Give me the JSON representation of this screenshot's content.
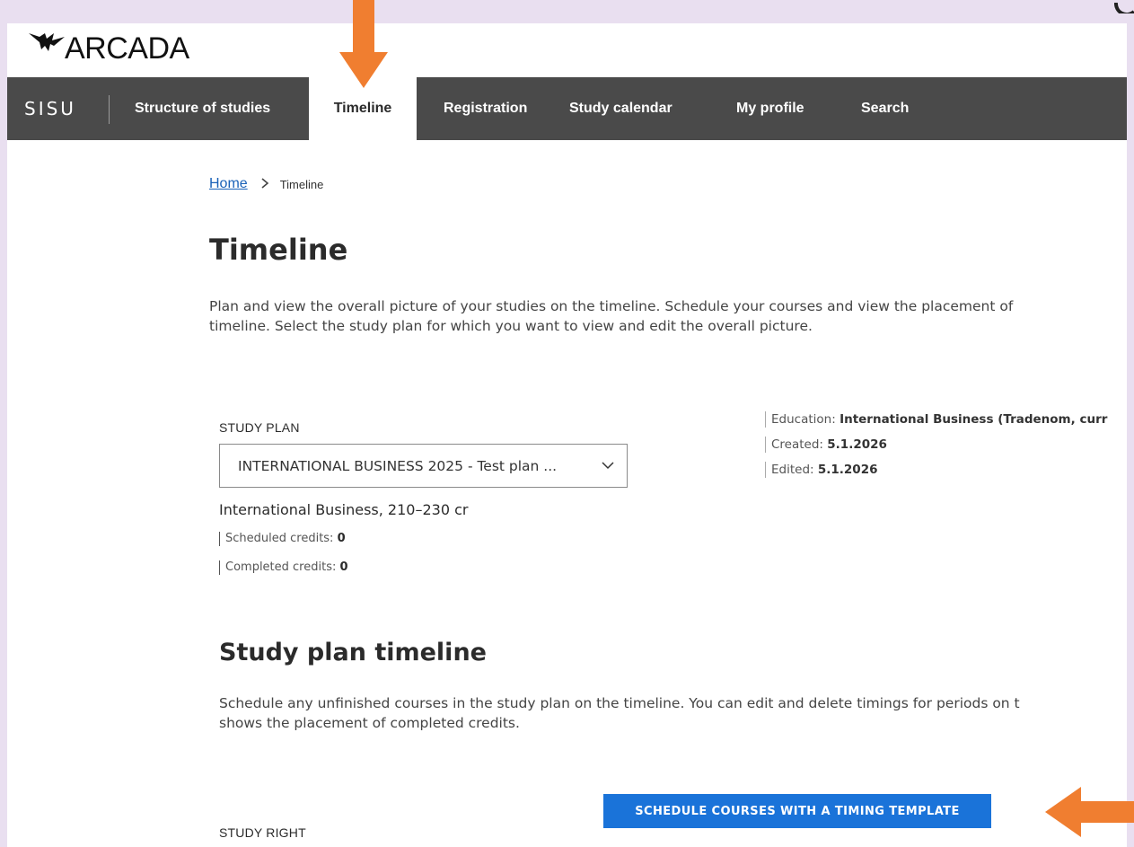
{
  "logo": {
    "text": "ARCADA"
  },
  "nav": {
    "brand": "SISU",
    "items": [
      {
        "label": "Structure of studies"
      },
      {
        "label": "Timeline"
      },
      {
        "label": "Registration"
      },
      {
        "label": "Study calendar"
      },
      {
        "label": "My profile"
      },
      {
        "label": "Search"
      }
    ],
    "active_index": 1
  },
  "breadcrumb": {
    "home": "Home",
    "current": "Timeline"
  },
  "page": {
    "title": "Timeline",
    "intro": "Plan and view the overall picture of your studies on the timeline. Schedule your courses and view the placement of\ntimeline. Select the study plan for which you want to view and edit the overall picture."
  },
  "study_plan": {
    "label": "STUDY PLAN",
    "selected": "INTERNATIONAL BUSINESS 2025 - Test plan ...",
    "program": "International Business, 210–230 cr",
    "scheduled_label": "Scheduled credits:",
    "scheduled_value": "0",
    "completed_label": "Completed credits:",
    "completed_value": "0"
  },
  "plan_info": {
    "education_label": "Education:",
    "education_value": "International Business (Tradenom, curr",
    "created_label": "Created:",
    "created_value": "5.1.2026",
    "edited_label": "Edited:",
    "edited_value": "5.1.2026"
  },
  "timeline_section": {
    "title": "Study plan timeline",
    "intro": "Schedule any unfinished courses in the study plan on the timeline. You can edit and delete timings for periods on t\nshows the placement of completed credits.",
    "study_right_label": "STUDY RIGHT",
    "button_label": "SCHEDULE COURSES WITH A TIMING TEMPLATE"
  },
  "colors": {
    "nav_bg": "#4a4a4a",
    "accent_blue": "#1a73d9",
    "arrow_orange": "#f07e30",
    "frame_bg": "#e9dff0"
  },
  "icons": {
    "logo": "arcada-bird-icon",
    "select_caret": "chevron-down-icon",
    "breadcrumb_separator": "chevron-right-icon",
    "annotation_down": "arrow-down-icon",
    "annotation_left": "arrow-left-icon"
  }
}
